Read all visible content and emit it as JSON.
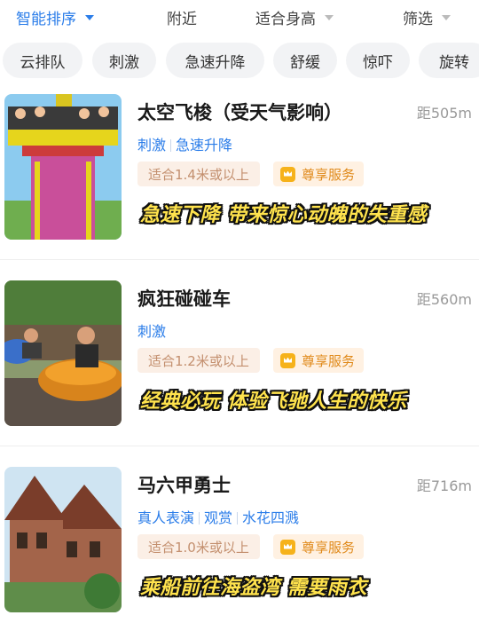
{
  "sort_bar": {
    "smart_sort": "智能排序",
    "nearby": "附近",
    "height_fit": "适合身高",
    "filter": "筛选"
  },
  "tag_chips": [
    "云排队",
    "刺激",
    "急速升降",
    "舒缓",
    "惊吓",
    "旋转"
  ],
  "rides": [
    {
      "name": "太空飞梭（受天气影响）",
      "distance": "距505m",
      "tags": [
        "刺激",
        "急速升降"
      ],
      "height_requirement": "适合1.4米或以上",
      "service": "尊享服务",
      "caption": "急速下降 带来惊心动魄的失重感"
    },
    {
      "name": "疯狂碰碰车",
      "distance": "距560m",
      "tags": [
        "刺激"
      ],
      "height_requirement": "适合1.2米或以上",
      "service": "尊享服务",
      "caption": "经典必玩 体验飞驰人生的快乐"
    },
    {
      "name": "马六甲勇士",
      "distance": "距716m",
      "tags": [
        "真人表演",
        "观赏",
        "水花四溅"
      ],
      "height_requirement": "适合1.0米或以上",
      "service": "尊享服务",
      "caption": "乘船前往海盗湾 需要雨衣"
    }
  ],
  "colors": {
    "accent": "#2b7de9",
    "caption_fill": "#ffe34d",
    "service_gold": "#f6b21a"
  }
}
